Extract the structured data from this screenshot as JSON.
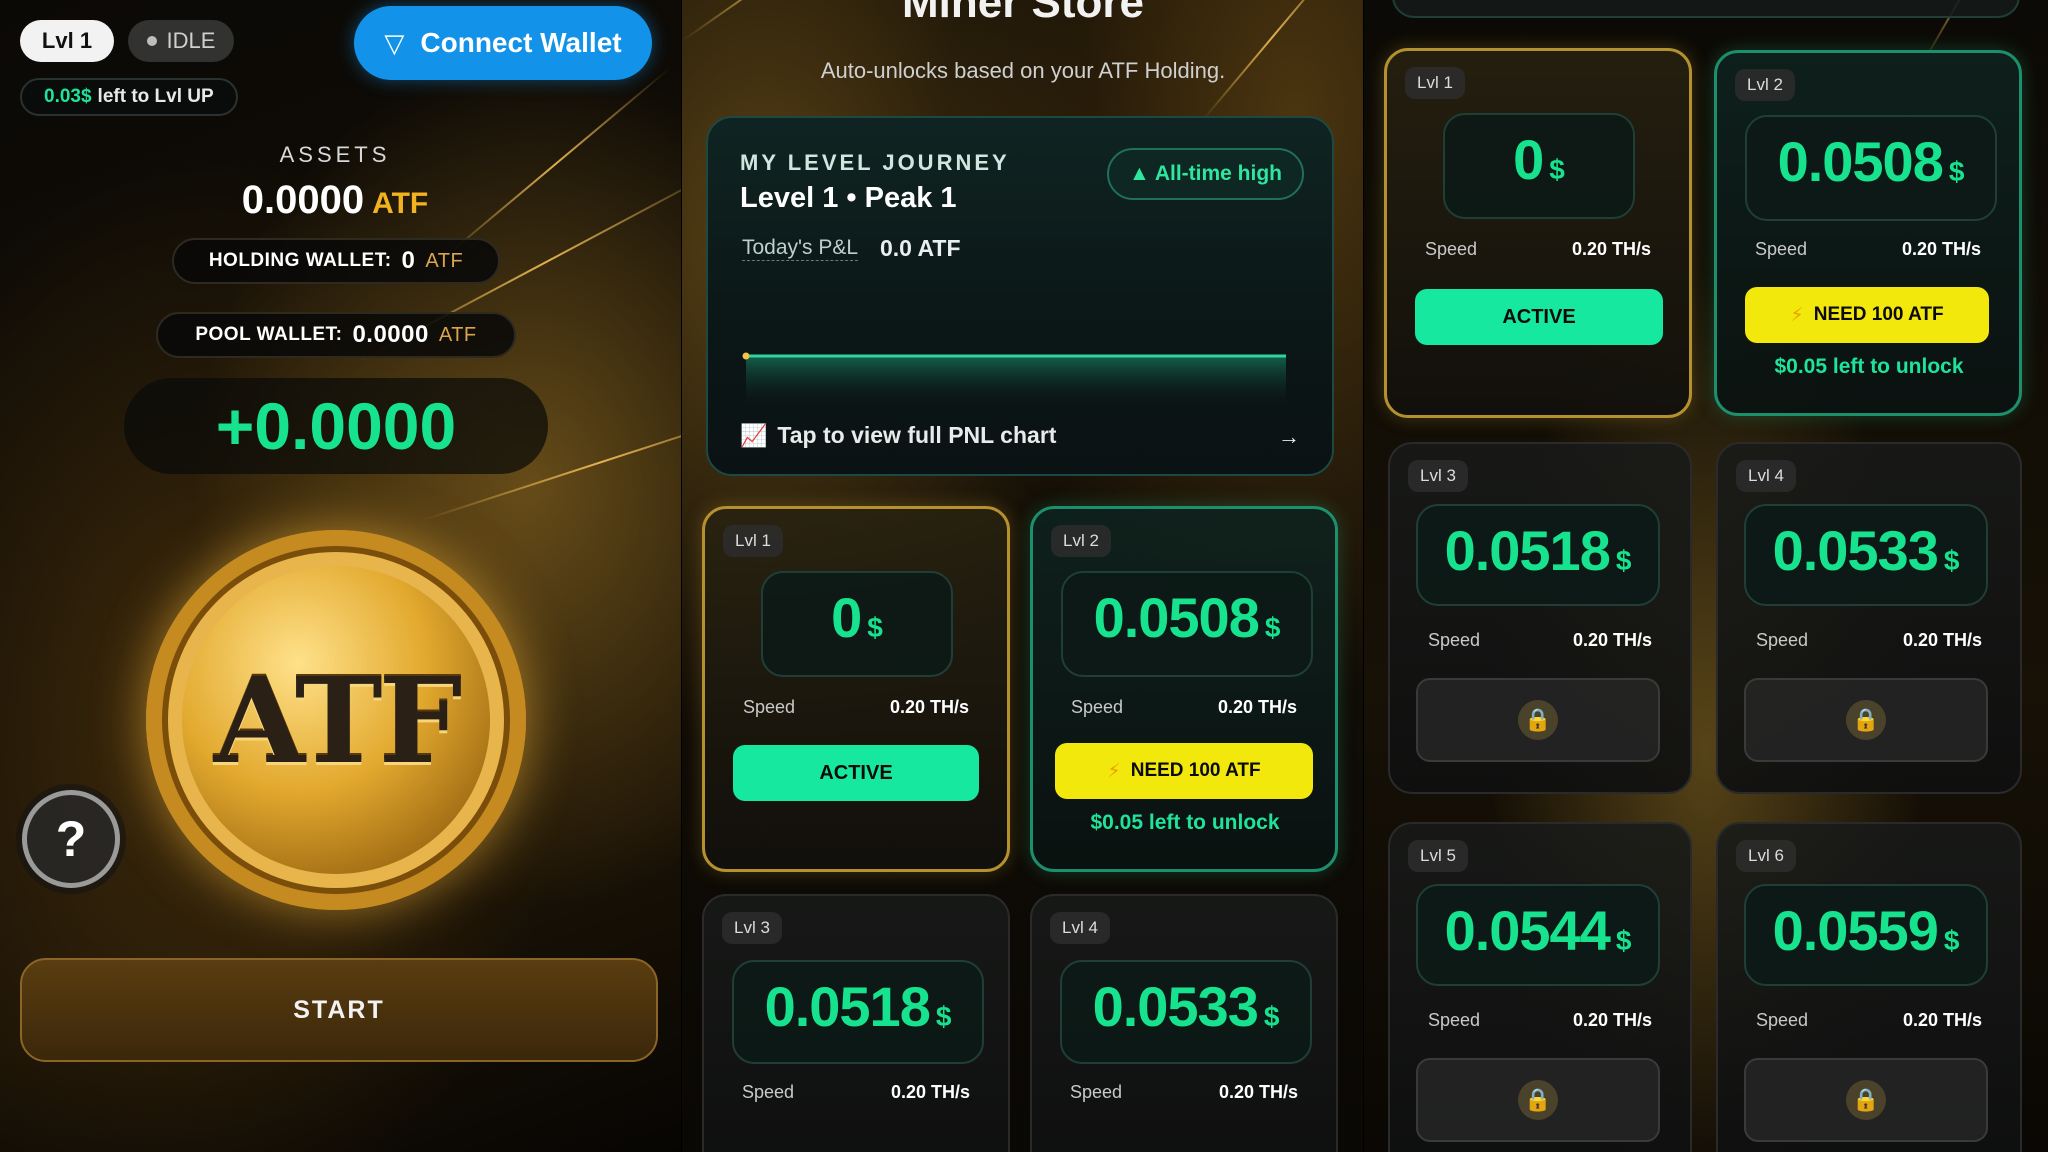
{
  "panel1": {
    "level_pill": "Lvl 1",
    "status_pill": "IDLE",
    "connect_wallet": "Connect Wallet",
    "lvl_up_amount": "0.03$",
    "lvl_up_text": "left to Lvl UP",
    "assets_label": "ASSETS",
    "assets_value": "0.0000",
    "assets_currency": "ATF",
    "holding_wallet_label": "HOLDING WALLET:",
    "holding_wallet_value": "0",
    "holding_wallet_unit": "ATF",
    "pool_wallet_label": "POOL WALLET:",
    "pool_wallet_value": "0.0000",
    "pool_wallet_unit": "ATF",
    "gain_value": "+0.0000",
    "coin_text": "ATF",
    "help_icon": "?",
    "start_button": "START"
  },
  "panel2": {
    "store_title": "Miner Store",
    "store_subtitle": "Auto-unlocks based on your ATF Holding.",
    "journey": {
      "title": "MY LEVEL JOURNEY",
      "level_text": "Level 1 • Peak 1",
      "badge": "▲ All-time high",
      "pnl_label": "Today's P&L",
      "pnl_value": "0.0 ATF",
      "tap_text": "Tap to view full PNL chart",
      "arrow": "→"
    },
    "cards": [
      {
        "level": "Lvl 1",
        "price": "0",
        "currency": "$",
        "speed_label": "Speed",
        "speed_value": "0.20 TH/s",
        "button": "ACTIVE"
      },
      {
        "level": "Lvl 2",
        "price": "0.0508",
        "currency": "$",
        "speed_label": "Speed",
        "speed_value": "0.20 TH/s",
        "button": "NEED 100 ATF",
        "unlock_text": "$0.05 left to unlock"
      },
      {
        "level": "Lvl 3",
        "price": "0.0518",
        "currency": "$",
        "speed_label": "Speed",
        "speed_value": "0.20 TH/s"
      },
      {
        "level": "Lvl 4",
        "price": "0.0533",
        "currency": "$",
        "speed_label": "Speed",
        "speed_value": "0.20 TH/s"
      }
    ]
  },
  "panel3": {
    "cards": [
      {
        "level": "Lvl 1",
        "price": "0",
        "currency": "$",
        "speed_label": "Speed",
        "speed_value": "0.20 TH/s",
        "button": "ACTIVE"
      },
      {
        "level": "Lvl 2",
        "price": "0.0508",
        "currency": "$",
        "speed_label": "Speed",
        "speed_value": "0.20 TH/s",
        "button": "NEED 100 ATF",
        "unlock_text": "$0.05 left to unlock"
      },
      {
        "level": "Lvl 3",
        "price": "0.0518",
        "currency": "$",
        "speed_label": "Speed",
        "speed_value": "0.20 TH/s"
      },
      {
        "level": "Lvl 4",
        "price": "0.0533",
        "currency": "$",
        "speed_label": "Speed",
        "speed_value": "0.20 TH/s"
      },
      {
        "level": "Lvl 5",
        "price": "0.0544",
        "currency": "$",
        "speed_label": "Speed",
        "speed_value": "0.20 TH/s"
      },
      {
        "level": "Lvl 6",
        "price": "0.0559",
        "currency": "$",
        "speed_label": "Speed",
        "speed_value": "0.20 TH/s"
      }
    ]
  },
  "icons": {
    "wallet": "wallet-icon",
    "lock": "lock-icon",
    "bolt": "bolt-icon",
    "chart": "chart-icon",
    "help": "help-icon"
  },
  "colors": {
    "accent_green": "#17e38f",
    "accent_gold": "#f3b31f",
    "wallet_blue": "#1292e8",
    "need_yellow": "#f2e80c"
  }
}
